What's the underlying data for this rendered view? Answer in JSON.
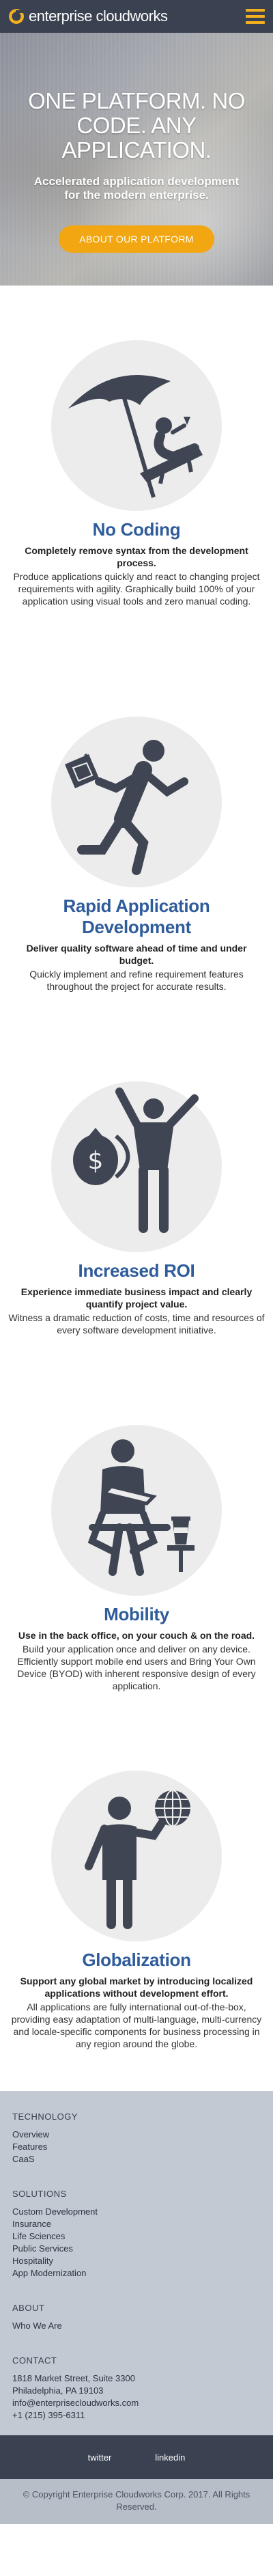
{
  "header": {
    "logo_text": "enterprise cloudworks",
    "logo_icon": "ec-circle-logo",
    "menu_icon": "hamburger-icon",
    "accent": "#f2b01e",
    "bg": "#3a4150"
  },
  "hero": {
    "title": "ONE PLATFORM. NO CODE. ANY APPLICATION.",
    "subtitle": "Accelerated application development for the modern enterprise.",
    "button_label": "ABOUT OUR PLATFORM",
    "button_color": "#f2a611"
  },
  "features": [
    {
      "icon": "beach-umbrella-lounger-icon",
      "title": "No Coding",
      "lead": "Completely remove syntax from the development process.",
      "body": "Produce applications quickly and react to changing project requirements with agility. Graphically build 100% of your application using visual tools and zero manual coding."
    },
    {
      "icon": "running-man-flag-icon",
      "title": "Rapid Application Development",
      "lead": "Deliver quality software ahead of time and under budget.",
      "body": "Quickly implement and refine requirement features throughout the project for accurate results."
    },
    {
      "icon": "money-bag-person-icon",
      "title": "Increased ROI",
      "lead": "Experience immediate business impact and clearly quantify project value.",
      "body": "Witness a dramatic reduction of costs, time and resources of every software development initiative."
    },
    {
      "icon": "person-laptop-coffee-icon",
      "title": "Mobility",
      "lead": "Use in the back office, on your couch & on the road.",
      "body": "Build your application once and deliver on any device. Efficiently support mobile end users and Bring Your Own Device (BYOD) with inherent responsive design of every application."
    },
    {
      "icon": "person-globe-icon",
      "title": "Globalization",
      "lead": "Support any global market by introducing localized applications without development effort.",
      "body": "All applications are fully international out-of-the-box, providing easy adaptation of multi-language, multi-currency and locale-specific components for business processing in any region around the globe."
    }
  ],
  "footer": {
    "technology": {
      "heading": "TECHNOLOGY",
      "items": [
        "Overview",
        "Features",
        "CaaS"
      ]
    },
    "solutions": {
      "heading": "SOLUTIONS",
      "items": [
        "Custom Development",
        "Insurance",
        "Life Sciences",
        "Public Services",
        "Hospitality",
        "App Modernization"
      ]
    },
    "about": {
      "heading": "ABOUT",
      "items": [
        "Who We Are"
      ]
    },
    "contact": {
      "heading": "CONTACT",
      "lines": [
        "1818 Market Street, Suite 3300",
        "Philadelphia, PA 19103",
        "info@enterprisecloudworks.com",
        "+1 (215) 395-6311"
      ]
    },
    "social": [
      "twitter",
      "linkedin"
    ],
    "copyright": "© Copyright Enterprise Cloudworks Corp. 2017. All Rights Reserved."
  }
}
